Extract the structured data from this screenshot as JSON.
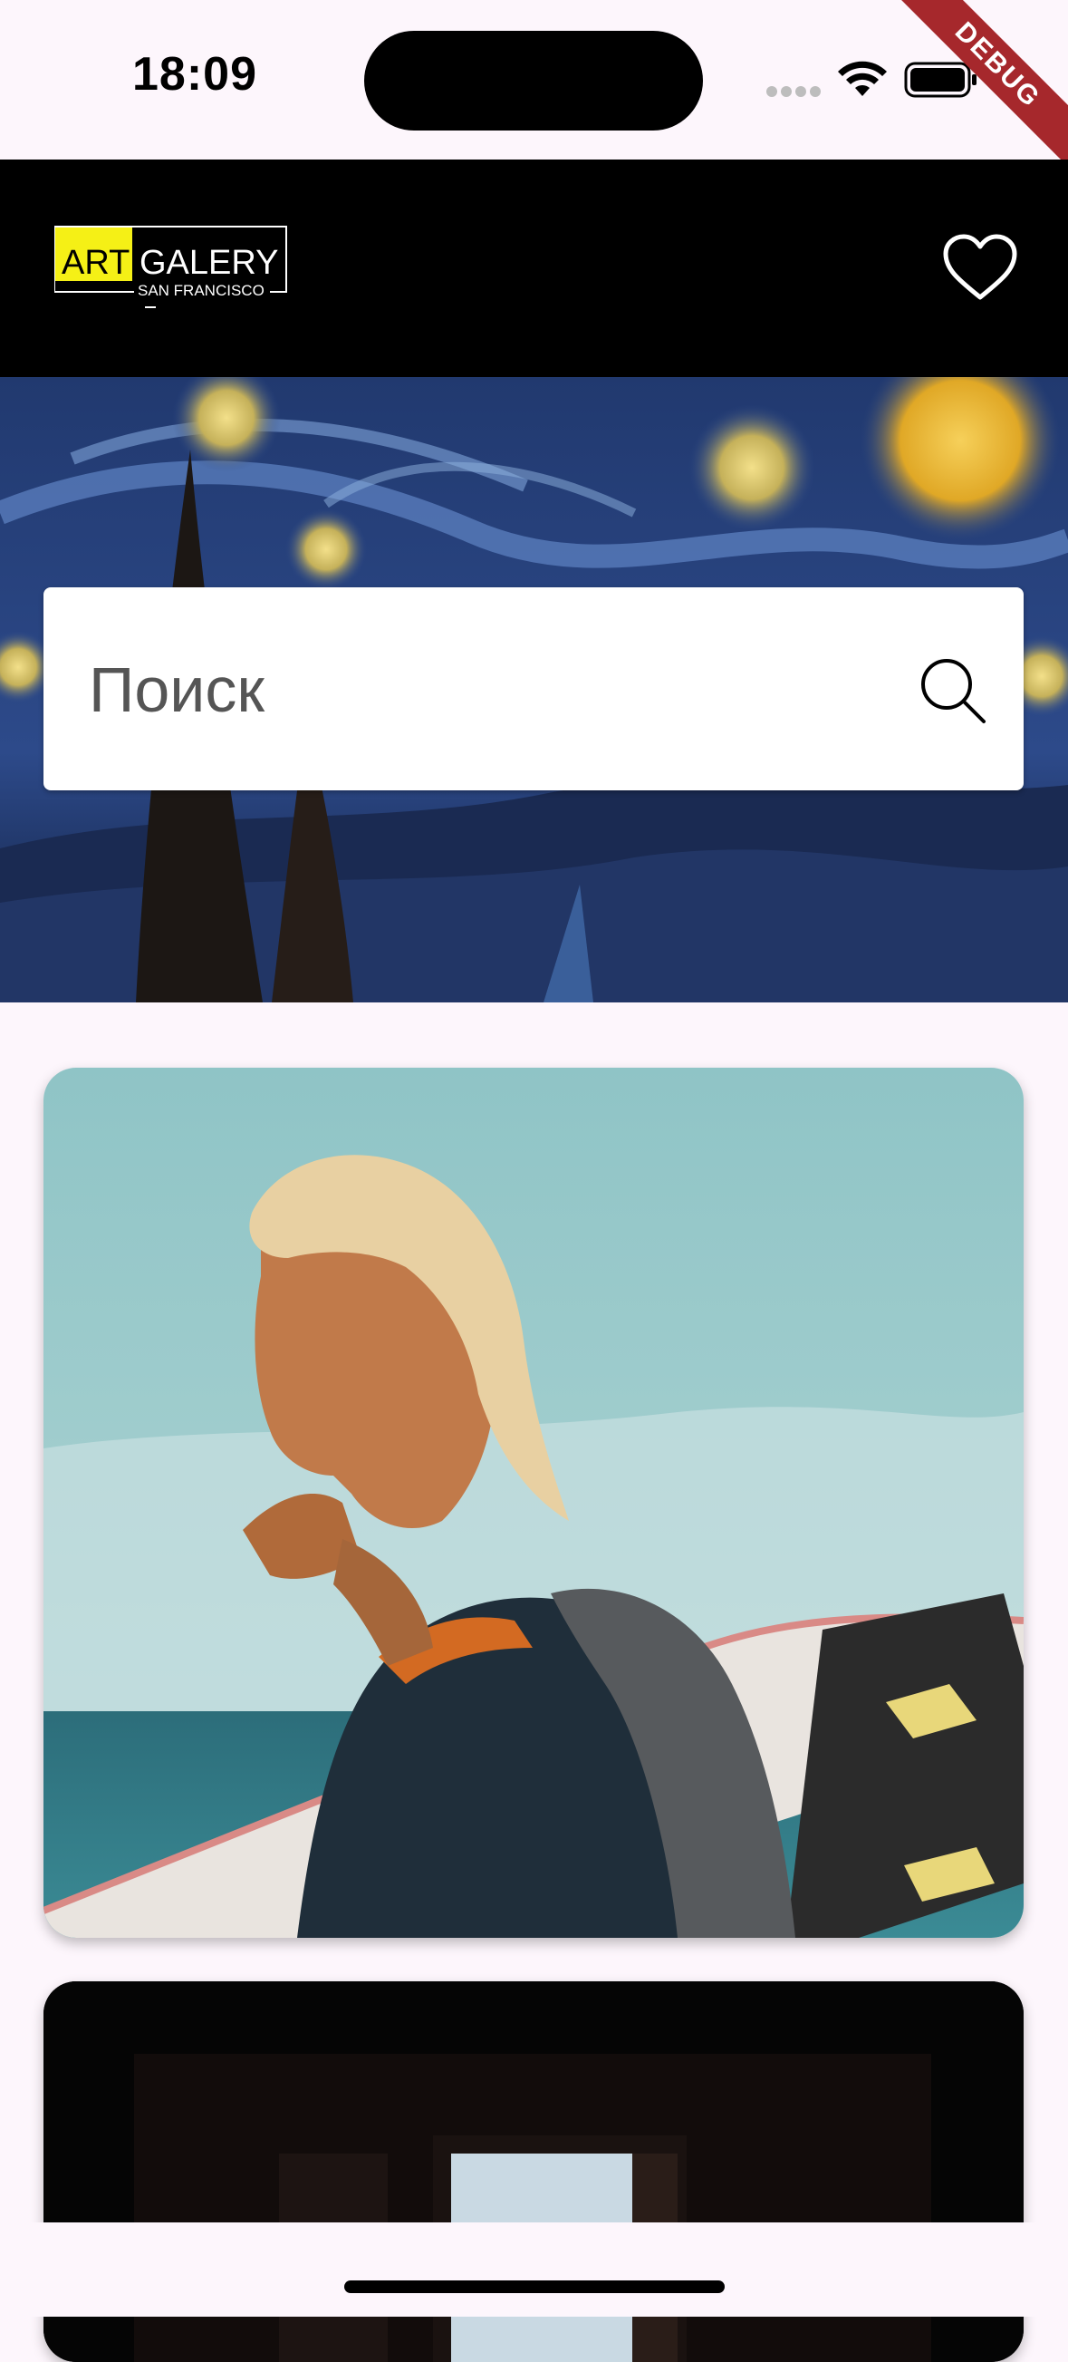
{
  "status_bar": {
    "time": "18:09",
    "debug_label": "DEBUG"
  },
  "header": {
    "logo": {
      "word1": "ART",
      "word2": "GALERY",
      "subtitle": "SAN FRANCISCO",
      "accent_color": "#f5f016"
    },
    "favorites_icon": "heart-icon"
  },
  "hero": {
    "description_icon": "starry-night-painting"
  },
  "search": {
    "placeholder": "Поиск",
    "icon": "search-icon"
  },
  "gallery": {
    "items": [
      {
        "image": "surfer-photo"
      },
      {
        "image": "dark-doorway-photo"
      }
    ]
  }
}
